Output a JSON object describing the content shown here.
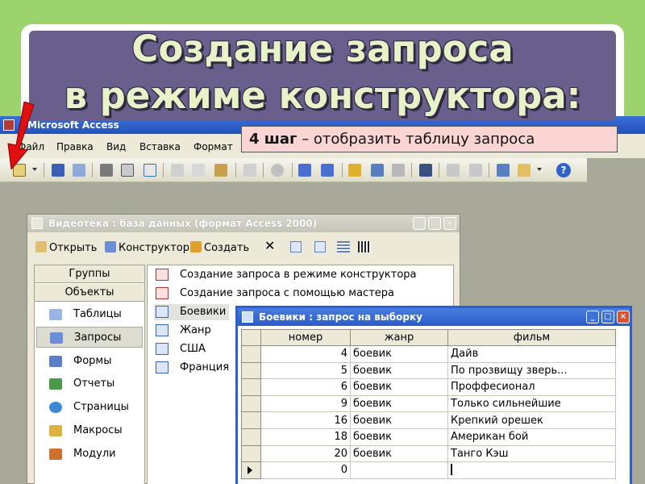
{
  "slide": {
    "title_line1": "Создание запроса",
    "title_line2": "в режиме конструктора:",
    "callout_step": "4 шаг",
    "callout_text": " – отобразить таблицу запроса"
  },
  "app": {
    "title": "Microsoft Access",
    "menu": [
      "Файл",
      "Правка",
      "Вид",
      "Вставка",
      "Формат"
    ]
  },
  "db_window": {
    "title": "Видеотека : база данных (формат Access 2000)",
    "toolbar": {
      "open_label": "Открыть",
      "design_label": "Конструктор",
      "create_label": "Создать"
    },
    "groups_label": "Группы",
    "objects_label": "Объекты",
    "objects": [
      "Таблицы",
      "Запросы",
      "Формы",
      "Отчеты",
      "Страницы",
      "Макросы",
      "Модули"
    ],
    "selected_object": "Запросы",
    "query_items": [
      "Создание запроса в режиме конструктора",
      "Создание запроса с помощью мастера",
      "Боевики",
      "Жанр",
      "США",
      "Франция"
    ]
  },
  "query_window": {
    "title": "Боевики : запрос на выборку",
    "columns": [
      "номер",
      "жанр",
      "фильм"
    ],
    "rows": [
      [
        "4",
        "боевик",
        "Дайв"
      ],
      [
        "5",
        "боевик",
        "По прозвищу зверь..."
      ],
      [
        "6",
        "боевик",
        "Проффесионал"
      ],
      [
        "9",
        "боевик",
        "Только сильнейшие"
      ],
      [
        "16",
        "боевик",
        "Крепкий орешек"
      ],
      [
        "18",
        "боевик",
        "Американ бой"
      ],
      [
        "20",
        "боевик",
        "Танго Кэш"
      ]
    ],
    "new_row_number": "0"
  },
  "colors": {
    "background_green": "#9dd36c",
    "title_band": "#6a5f8c",
    "callout_bg": "#fbd4d4",
    "xp_blue": "#2d5fd0",
    "arrow_red": "#e01010"
  }
}
